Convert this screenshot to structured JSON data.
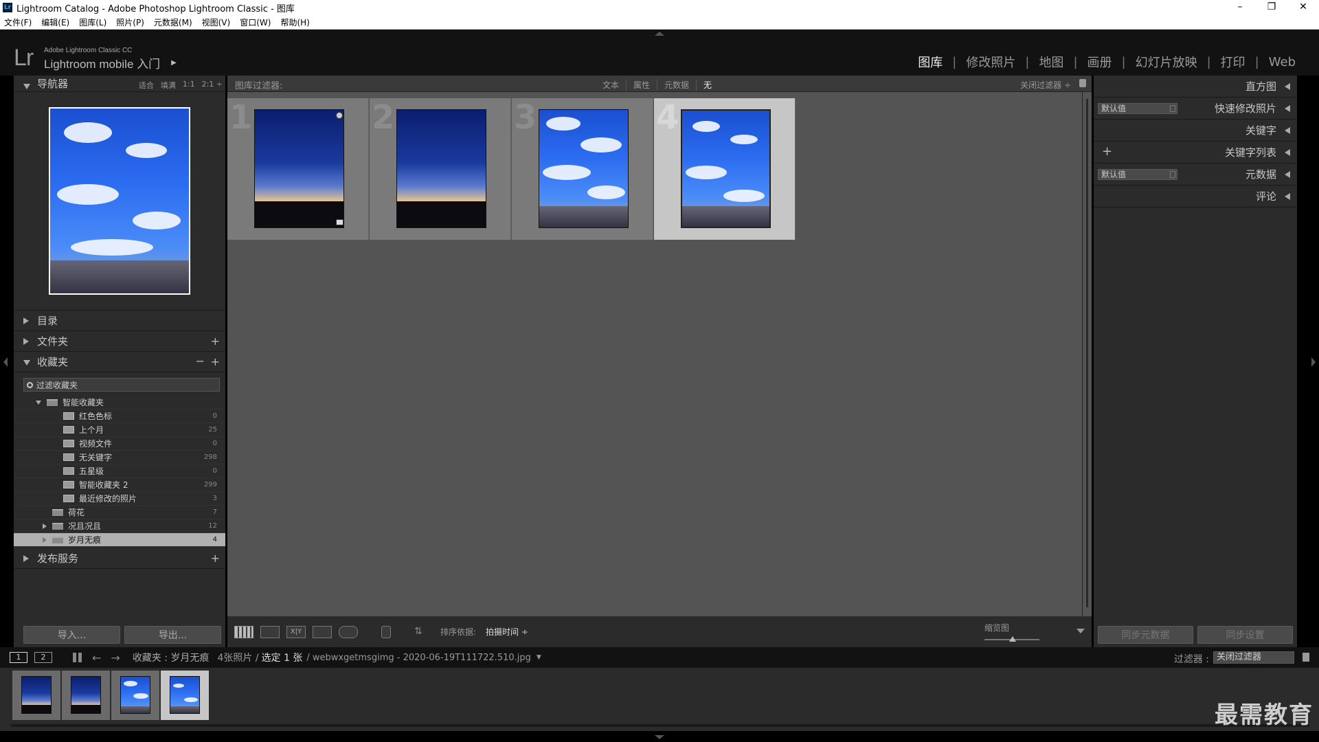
{
  "window": {
    "title": "Lightroom Catalog - Adobe Photoshop Lightroom Classic - 图库",
    "controls": [
      "–",
      "❐",
      "✕"
    ]
  },
  "menu": [
    "文件(F)",
    "编辑(E)",
    "图库(L)",
    "照片(P)",
    "元数据(M)",
    "视图(V)",
    "窗口(W)",
    "帮助(H)"
  ],
  "identity": {
    "logo": "Lr",
    "line1": "Adobe Lightroom Classic CC",
    "line2": "Lightroom mobile 入门"
  },
  "modules": [
    {
      "label": "图库",
      "active": true
    },
    {
      "label": "修改照片",
      "active": false
    },
    {
      "label": "地图",
      "active": false
    },
    {
      "label": "画册",
      "active": false
    },
    {
      "label": "幻灯片放映",
      "active": false
    },
    {
      "label": "打印",
      "active": false
    },
    {
      "label": "Web",
      "active": false
    }
  ],
  "navigator": {
    "title": "导航器",
    "zooms": [
      "适合",
      "填满",
      "1:1",
      "2:1 ÷"
    ]
  },
  "left_sections": {
    "catalog": "目录",
    "folders": "文件夹",
    "collections": "收藏夹",
    "publish": "发布服务",
    "plus": "+",
    "minus": "−"
  },
  "collections": {
    "search_placeholder": "过滤收藏夹",
    "smart_set": "智能收藏夹",
    "smart_items": [
      {
        "name": "红色色标",
        "count": "0"
      },
      {
        "name": "上个月",
        "count": "25"
      },
      {
        "name": "视频文件",
        "count": "0"
      },
      {
        "name": "无关键字",
        "count": "298"
      },
      {
        "name": "五星级",
        "count": "0"
      },
      {
        "name": "智能收藏夹 2",
        "count": "299"
      },
      {
        "name": "最近修改的照片",
        "count": "3"
      }
    ],
    "folders": [
      {
        "name": "荷花",
        "count": "7"
      },
      {
        "name": "况且况且",
        "count": "12"
      },
      {
        "name": "岁月无痕",
        "count": "4"
      }
    ]
  },
  "left_buttons": {
    "import": "导入...",
    "export": "导出..."
  },
  "filter_bar": {
    "label": "图库过滤器:",
    "options": [
      "文本",
      "属性",
      "元数据",
      "无"
    ],
    "off": "关闭过滤器 ÷"
  },
  "grid": {
    "cells": [
      {
        "index": "1",
        "style": "sunset",
        "selected": false
      },
      {
        "index": "2",
        "style": "sunset",
        "selected": false
      },
      {
        "index": "3",
        "style": "blue",
        "selected": false
      },
      {
        "index": "4",
        "style": "blue",
        "selected": true
      }
    ]
  },
  "toolbar": {
    "sort_label": "排序依据:",
    "sort_value": "拍摄时间 ÷",
    "thumb_label": "缩览图",
    "xy": "X|Y"
  },
  "right_panel": {
    "histogram": "直方图",
    "quick_develop": "快速修改照片",
    "quick_develop_preset": "默认值",
    "keywording": "关键字",
    "keyword_list": "关键字列表",
    "metadata": "元数据",
    "metadata_preset": "默认值",
    "comments": "评论",
    "sync_metadata": "同步元数据",
    "sync_settings": "同步设置",
    "plus": "+"
  },
  "filmstrip_bar": {
    "page1": "1",
    "page2": "2",
    "back": "←",
    "forward": "→",
    "source": "收藏夹 : 岁月无痕",
    "count": "4张照片 /",
    "selected": "选定 1 张",
    "filename": "/ webwxgetmsgimg - 2020-06-19T111722.510.jpg",
    "dropdown": "▼",
    "filter_label": "过滤器 :",
    "filter_value": "关闭过滤器"
  },
  "filmstrip": {
    "cells": [
      {
        "style": "sunset",
        "selected": false
      },
      {
        "style": "sunset",
        "selected": false
      },
      {
        "style": "blue",
        "selected": false
      },
      {
        "style": "blue",
        "selected": true
      }
    ]
  },
  "watermark": "最需教育"
}
